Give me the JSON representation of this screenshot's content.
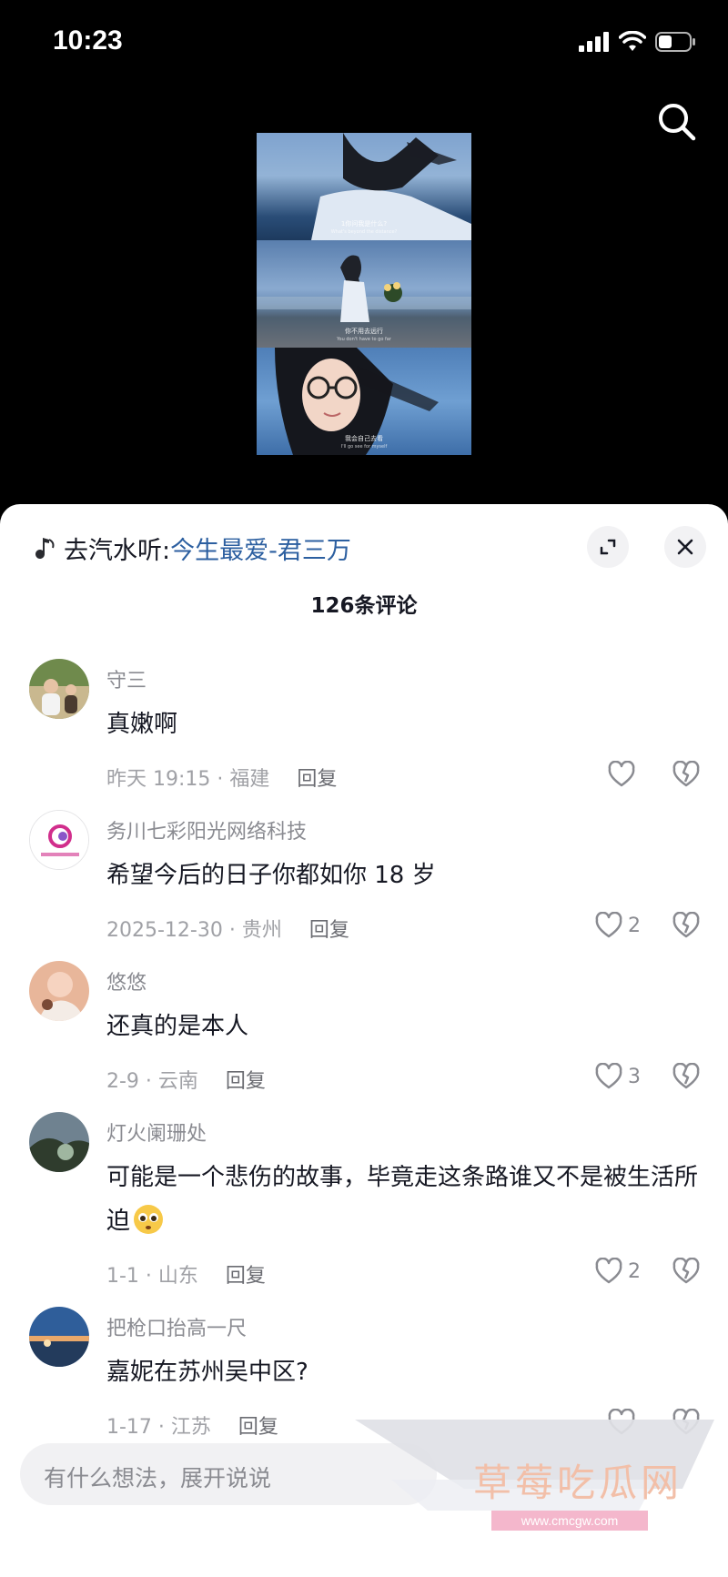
{
  "status_bar": {
    "time": "10:23",
    "icons": [
      "signal-icon",
      "wifi-icon",
      "battery-icon"
    ]
  },
  "video": {
    "subtitles": [
      {
        "zh": "1你问我是什么?",
        "en": "What's beyond the distance?"
      },
      {
        "zh": "你不用去远行",
        "en": "You don't have to go far"
      },
      {
        "zh": "我会自己去看",
        "en": "I'll go see for myself"
      }
    ]
  },
  "music": {
    "prefix": "去汽水听:",
    "title": "今生最爱-君三万"
  },
  "comments_header": "126条评论",
  "comments": [
    {
      "username": "守三",
      "text": "真嫩啊",
      "time_location": "昨天 19:15 · 福建",
      "reply_label": "回复",
      "likes": ""
    },
    {
      "username": "务川七彩阳光网络科技",
      "text": "希望今后的日子你都如你 18 岁",
      "time_location": "2025-12-30 · 贵州",
      "reply_label": "回复",
      "likes": "2"
    },
    {
      "username": "悠悠",
      "text": "还真的是本人",
      "time_location": "2-9 · 云南",
      "reply_label": "回复",
      "likes": "3"
    },
    {
      "username": "灯火阑珊处",
      "text": "可能是一个悲伤的故事，毕竟走这条路谁又不是被生活所迫",
      "time_location": "1-1 · 山东",
      "reply_label": "回复",
      "likes": "2"
    },
    {
      "username": "把枪口抬高一尺",
      "text": "嘉妮在苏州吴中区?",
      "time_location": "1-17 · 江苏",
      "reply_label": "回复",
      "likes": ""
    }
  ],
  "input": {
    "placeholder": "有什么想法，展开说说"
  },
  "watermark": {
    "text": "草莓吃瓜网",
    "url": "www.cmcgw.com"
  },
  "colors": {
    "music_title": "#2c5fa0",
    "meta_gray": "#a0a1a6",
    "sheet_bg": "#ffffff"
  }
}
